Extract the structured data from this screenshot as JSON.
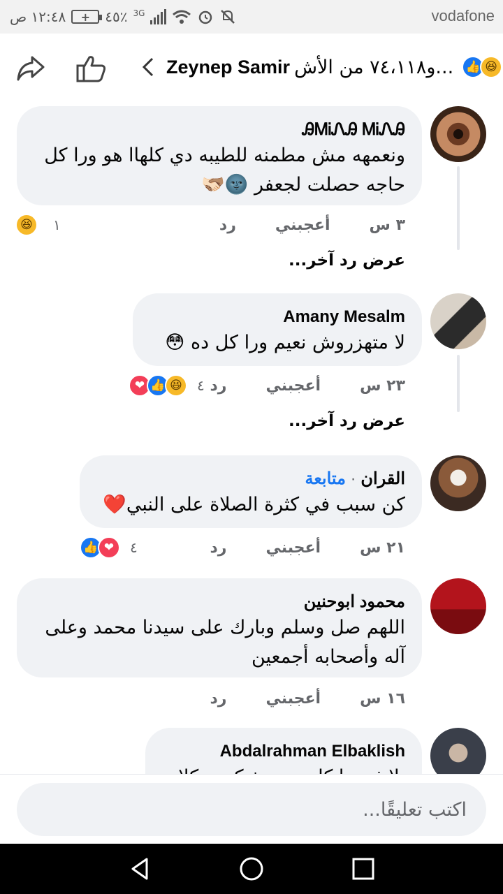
{
  "status_bar": {
    "carrier": "vodafone",
    "time": "١٢:٤٨ ص",
    "battery": "+",
    "battery_percent": "٤٥٪",
    "network": "3G"
  },
  "header": {
    "title_name": "Zeynep Samir",
    "title_others": "و٧٤،١١٨ من الأش...",
    "reactions": [
      "haha-icon",
      "like-icon"
    ]
  },
  "comments": [
    {
      "author": "ᎯᎷᎥᏁᎯ ᎷᎥᏁᎯ",
      "text": "ونعمهه مش مطمنه للطيبه دي كلهاا هو ورا كل حاجه حصلت لجعفر 🌚🫱🏻‍🫲🏽",
      "time": "٣ س",
      "like": "أعجبني",
      "reply": "رد",
      "reaction_count": "١",
      "reactions": [
        "haha"
      ],
      "more_replies": "عرض رد آخر..."
    },
    {
      "author": "Amany Mesalm",
      "text": "لا متهزروش نعيم ورا كل ده 😳",
      "time": "٢٣ س",
      "like": "أعجبني",
      "reply": "رد",
      "reaction_count": "٤",
      "reactions": [
        "haha",
        "like",
        "love"
      ],
      "more_replies": "عرض رد آخر..."
    },
    {
      "author": "القران",
      "follow": "متابعة",
      "text": "كن سبب في كثرة الصلاة على النبي❤️",
      "time": "٢١ س",
      "like": "أعجبني",
      "reply": "رد",
      "reaction_count": "٤",
      "reactions": [
        "love",
        "like"
      ]
    },
    {
      "author": "محمود ابوحنين",
      "text": "اللهم صل وسلم وبارك على سيدنا محمد وعلى آله وأصحابه أجمعين",
      "time": "١٦ س",
      "like": "أعجبني",
      "reply": "رد"
    },
    {
      "author": "Abdalrahman Elbaklish",
      "text": "بلاش يرا كل ينتو بتفتكرين كلام"
    }
  ],
  "composer": {
    "placeholder": "اكتب تعليقًا..."
  },
  "colors": {
    "accent": "#1877f2",
    "bubble": "#f0f2f5",
    "meta": "#65676b",
    "love": "#f33e58",
    "haha": "#f7b928"
  }
}
